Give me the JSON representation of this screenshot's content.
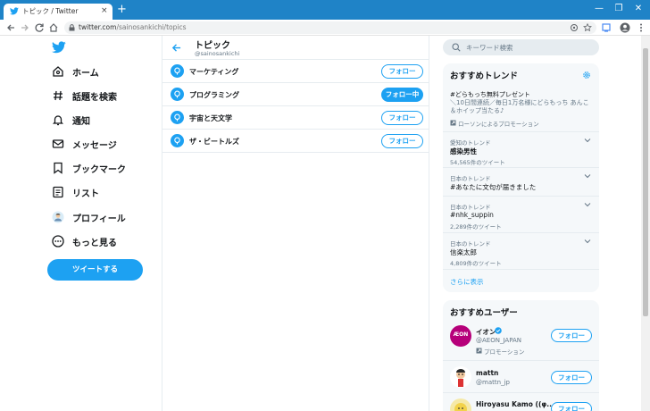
{
  "browser": {
    "tab_title": "トピック / Twitter",
    "tab_close": "×",
    "new_tab": "+",
    "url_host": "twitter.com",
    "url_path": "/sainosankichi/topics",
    "window_buttons": [
      "—",
      "❐",
      "✕"
    ]
  },
  "sidebar": {
    "items": [
      {
        "label": "ホーム",
        "icon": "home-icon"
      },
      {
        "label": "話題を検索",
        "icon": "hashtag-icon"
      },
      {
        "label": "通知",
        "icon": "bell-icon"
      },
      {
        "label": "メッセージ",
        "icon": "mail-icon"
      },
      {
        "label": "ブックマーク",
        "icon": "bookmark-icon"
      },
      {
        "label": "リスト",
        "icon": "list-icon"
      },
      {
        "label": "プロフィール",
        "icon": "avatar-icon"
      },
      {
        "label": "もっと見る",
        "icon": "more-icon"
      }
    ],
    "tweet_button": "ツイートする"
  },
  "main": {
    "title": "トピック",
    "handle": "@sainosankichi",
    "topics": [
      {
        "name": "マーケティング",
        "button": "フォロー",
        "following": false
      },
      {
        "name": "プログラミング",
        "button": "フォロー中",
        "following": true
      },
      {
        "name": "宇宙と天文学",
        "button": "フォロー",
        "following": false
      },
      {
        "name": "ザ・ビートルズ",
        "button": "フォロー",
        "following": false
      }
    ]
  },
  "right": {
    "search_placeholder": "キーワード検索",
    "trends": {
      "title": "おすすめトレンド",
      "items": [
        {
          "name": "#どらもっち無料プレゼント",
          "desc": "＼10日間連続／毎日1万名様にどらもっち あんこ＆ホイップ当たる♪",
          "promo": "ローソンによるプロモーション"
        },
        {
          "meta": "愛知のトレンド",
          "name": "感染男性",
          "count": "54,565件のツイート"
        },
        {
          "meta": "日本のトレンド",
          "name": "#あなたに文句が届きました"
        },
        {
          "meta": "日本のトレンド",
          "name": "#nhk_suppin",
          "count": "2,289件のツイート"
        },
        {
          "meta": "日本のトレンド",
          "name": "信楽太郎",
          "count": "4,809件のツイート"
        }
      ],
      "more": "さらに表示"
    },
    "users": {
      "title": "おすすめユーザー",
      "items": [
        {
          "name": "イオン",
          "handle": "@AEON_JAPAN",
          "promo": "プロモーション",
          "button": "フォロー",
          "avatar_text": "ÆON"
        },
        {
          "name": "mattn",
          "handle": "@mattn_jp",
          "button": "フォロー"
        },
        {
          "name": "Hiroyasu Kamo ((φ...",
          "button": "フォロー"
        }
      ]
    }
  },
  "colors": {
    "accent": "#1da1f2",
    "chrome": "#1f83c7",
    "aeon": "#b6007a"
  }
}
